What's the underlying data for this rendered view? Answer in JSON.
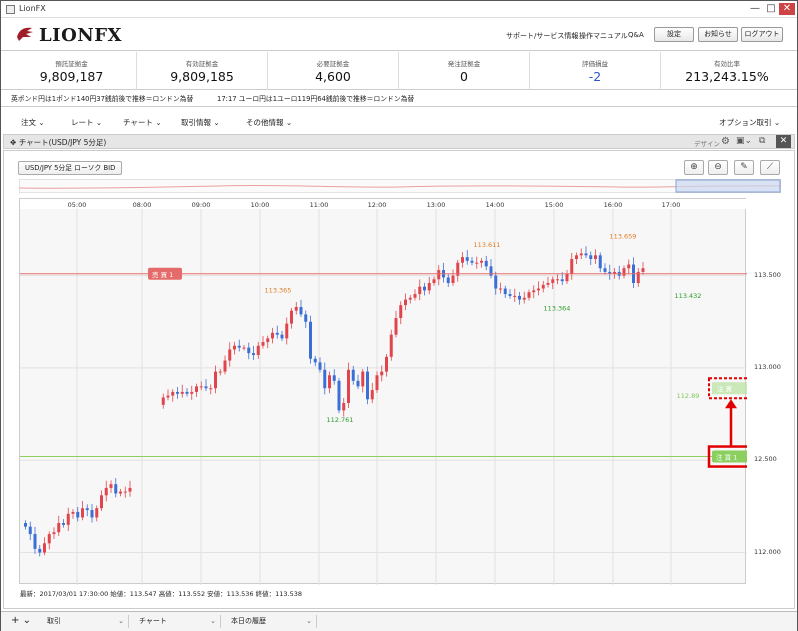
{
  "window": {
    "title": "LionFX",
    "min": "—",
    "max": "□",
    "close": "✕"
  },
  "brand": {
    "logo_text": "LIONFX"
  },
  "header_links": [
    "サポート/サービス情報",
    "操作マニュアル",
    "Q&A"
  ],
  "header_buttons": [
    "設定",
    "お知らせ",
    "ログアウト"
  ],
  "account": [
    {
      "label": "預託証拠金",
      "value": "9,809,187"
    },
    {
      "label": "有効証拠金",
      "value": "9,809,185"
    },
    {
      "label": "必要証拠金",
      "value": "4,600"
    },
    {
      "label": "発注証拠金",
      "value": "0"
    },
    {
      "label": "評価損益",
      "value": "-2"
    },
    {
      "label": "有効比率",
      "value": "213,243.15%"
    }
  ],
  "news": [
    {
      "text": "英ポンド円は1ポンド140円37銭前後で推移＝ロンドン為替"
    },
    {
      "text": "17:17  ユーロ円は1ユーロ119円64銭前後で推移＝ロンドン為替"
    }
  ],
  "menu": [
    "注文",
    "レート",
    "チャート",
    "取引情報",
    "その他情報"
  ],
  "menu_right": "オプション取引",
  "chart_panel": {
    "title": "チャート(USD/JPY 5分足)",
    "design_label": "デザイン",
    "symbol_button": "USD/JPY 5分足 ローソク BID"
  },
  "status_line": "最新：2017/03/01 17:30:00 始値：113.547 高値：113.552 安値：113.536 終値：113.538",
  "footer_tabs": [
    {
      "label": "取引"
    },
    {
      "label": "チャート"
    },
    {
      "label": "本日の履歴"
    }
  ],
  "footer_plus": "+",
  "colors": {
    "up": "#e0454b",
    "down": "#3b6fd6",
    "sell_line": "#e56b6b",
    "stop_line": "#8bcf5f",
    "highlight": "#e00000"
  },
  "icons": [
    "zoom-in-icon",
    "zoom-out-icon",
    "pen-icon",
    "line-tool-icon",
    "gear-icon",
    "restore-icon",
    "close-icon",
    "move-icon",
    "plus-icon"
  ],
  "chart_data": {
    "type": "candlestick",
    "x_ticks": [
      "05:00",
      "08:00",
      "09:00",
      "10:00",
      "11:00",
      "12:00",
      "13:00",
      "14:00",
      "15:00",
      "16:00",
      "17:00"
    ],
    "y_ticks": [
      "113.500",
      "113.000",
      "12.500",
      "112.000"
    ],
    "ylim": [
      111.9,
      113.85
    ],
    "annotations": [
      {
        "text": "113.365",
        "price": 113.365,
        "color": "#e07b20"
      },
      {
        "text": "112.761",
        "price": 112.761,
        "color": "#2a9d2a"
      },
      {
        "text": "113.611",
        "price": 113.611,
        "color": "#e07b20"
      },
      {
        "text": "113.364",
        "price": 113.364,
        "color": "#2a9d2a"
      },
      {
        "text": "113.659",
        "price": 113.659,
        "color": "#e07b20"
      },
      {
        "text": "113.432",
        "price": 113.432,
        "color": "#2a9d2a"
      },
      {
        "text": "112.89",
        "price": 112.89,
        "color": "#7ec85a"
      }
    ],
    "position_lines": [
      {
        "label": "売 買 1",
        "price": 113.51,
        "color": "#e56b6b"
      },
      {
        "label": "注 買 1",
        "price": 112.52,
        "color": "#8bcf5f"
      }
    ],
    "ghost_order": {
      "label": "注 買",
      "price": 112.89
    },
    "closes": [
      112.14,
      112.1,
      112.02,
      112.0,
      112.05,
      112.1,
      112.11,
      112.16,
      112.15,
      112.21,
      112.22,
      112.19,
      112.24,
      112.23,
      112.19,
      112.24,
      112.31,
      112.35,
      112.37,
      112.32,
      112.33,
      112.33,
      112.35,
      112.84,
      112.85,
      112.87,
      112.86,
      112.87,
      112.86,
      112.87,
      112.9,
      112.9,
      112.89,
      112.89,
      112.98,
      112.98,
      113.04,
      113.1,
      113.12,
      113.11,
      113.11,
      113.08,
      113.07,
      113.12,
      113.14,
      113.16,
      113.19,
      113.18,
      113.16,
      113.24,
      113.31,
      113.33,
      113.29,
      113.25,
      113.05,
      113.03,
      112.99,
      112.89,
      112.96,
      112.93,
      112.77,
      112.81,
      112.99,
      112.93,
      112.9,
      112.98,
      112.83,
      112.88,
      112.96,
      112.98,
      113.06,
      113.18,
      113.27,
      113.34,
      113.37,
      113.38,
      113.4,
      113.44,
      113.42,
      113.46,
      113.48,
      113.53,
      113.49,
      113.46,
      113.5,
      113.57,
      113.6,
      113.58,
      113.57,
      113.57,
      113.58,
      113.55,
      113.5,
      113.43,
      113.43,
      113.4,
      113.39,
      113.39,
      113.37,
      113.38,
      113.41,
      113.42,
      113.43,
      113.45,
      113.46,
      113.48,
      113.48,
      113.47,
      113.51,
      113.59,
      113.61,
      113.62,
      113.61,
      113.59,
      113.61,
      113.54,
      113.52,
      113.51,
      113.52,
      113.5,
      113.54,
      113.56,
      113.46,
      113.52,
      113.54
    ],
    "gaps": [
      23
    ]
  }
}
